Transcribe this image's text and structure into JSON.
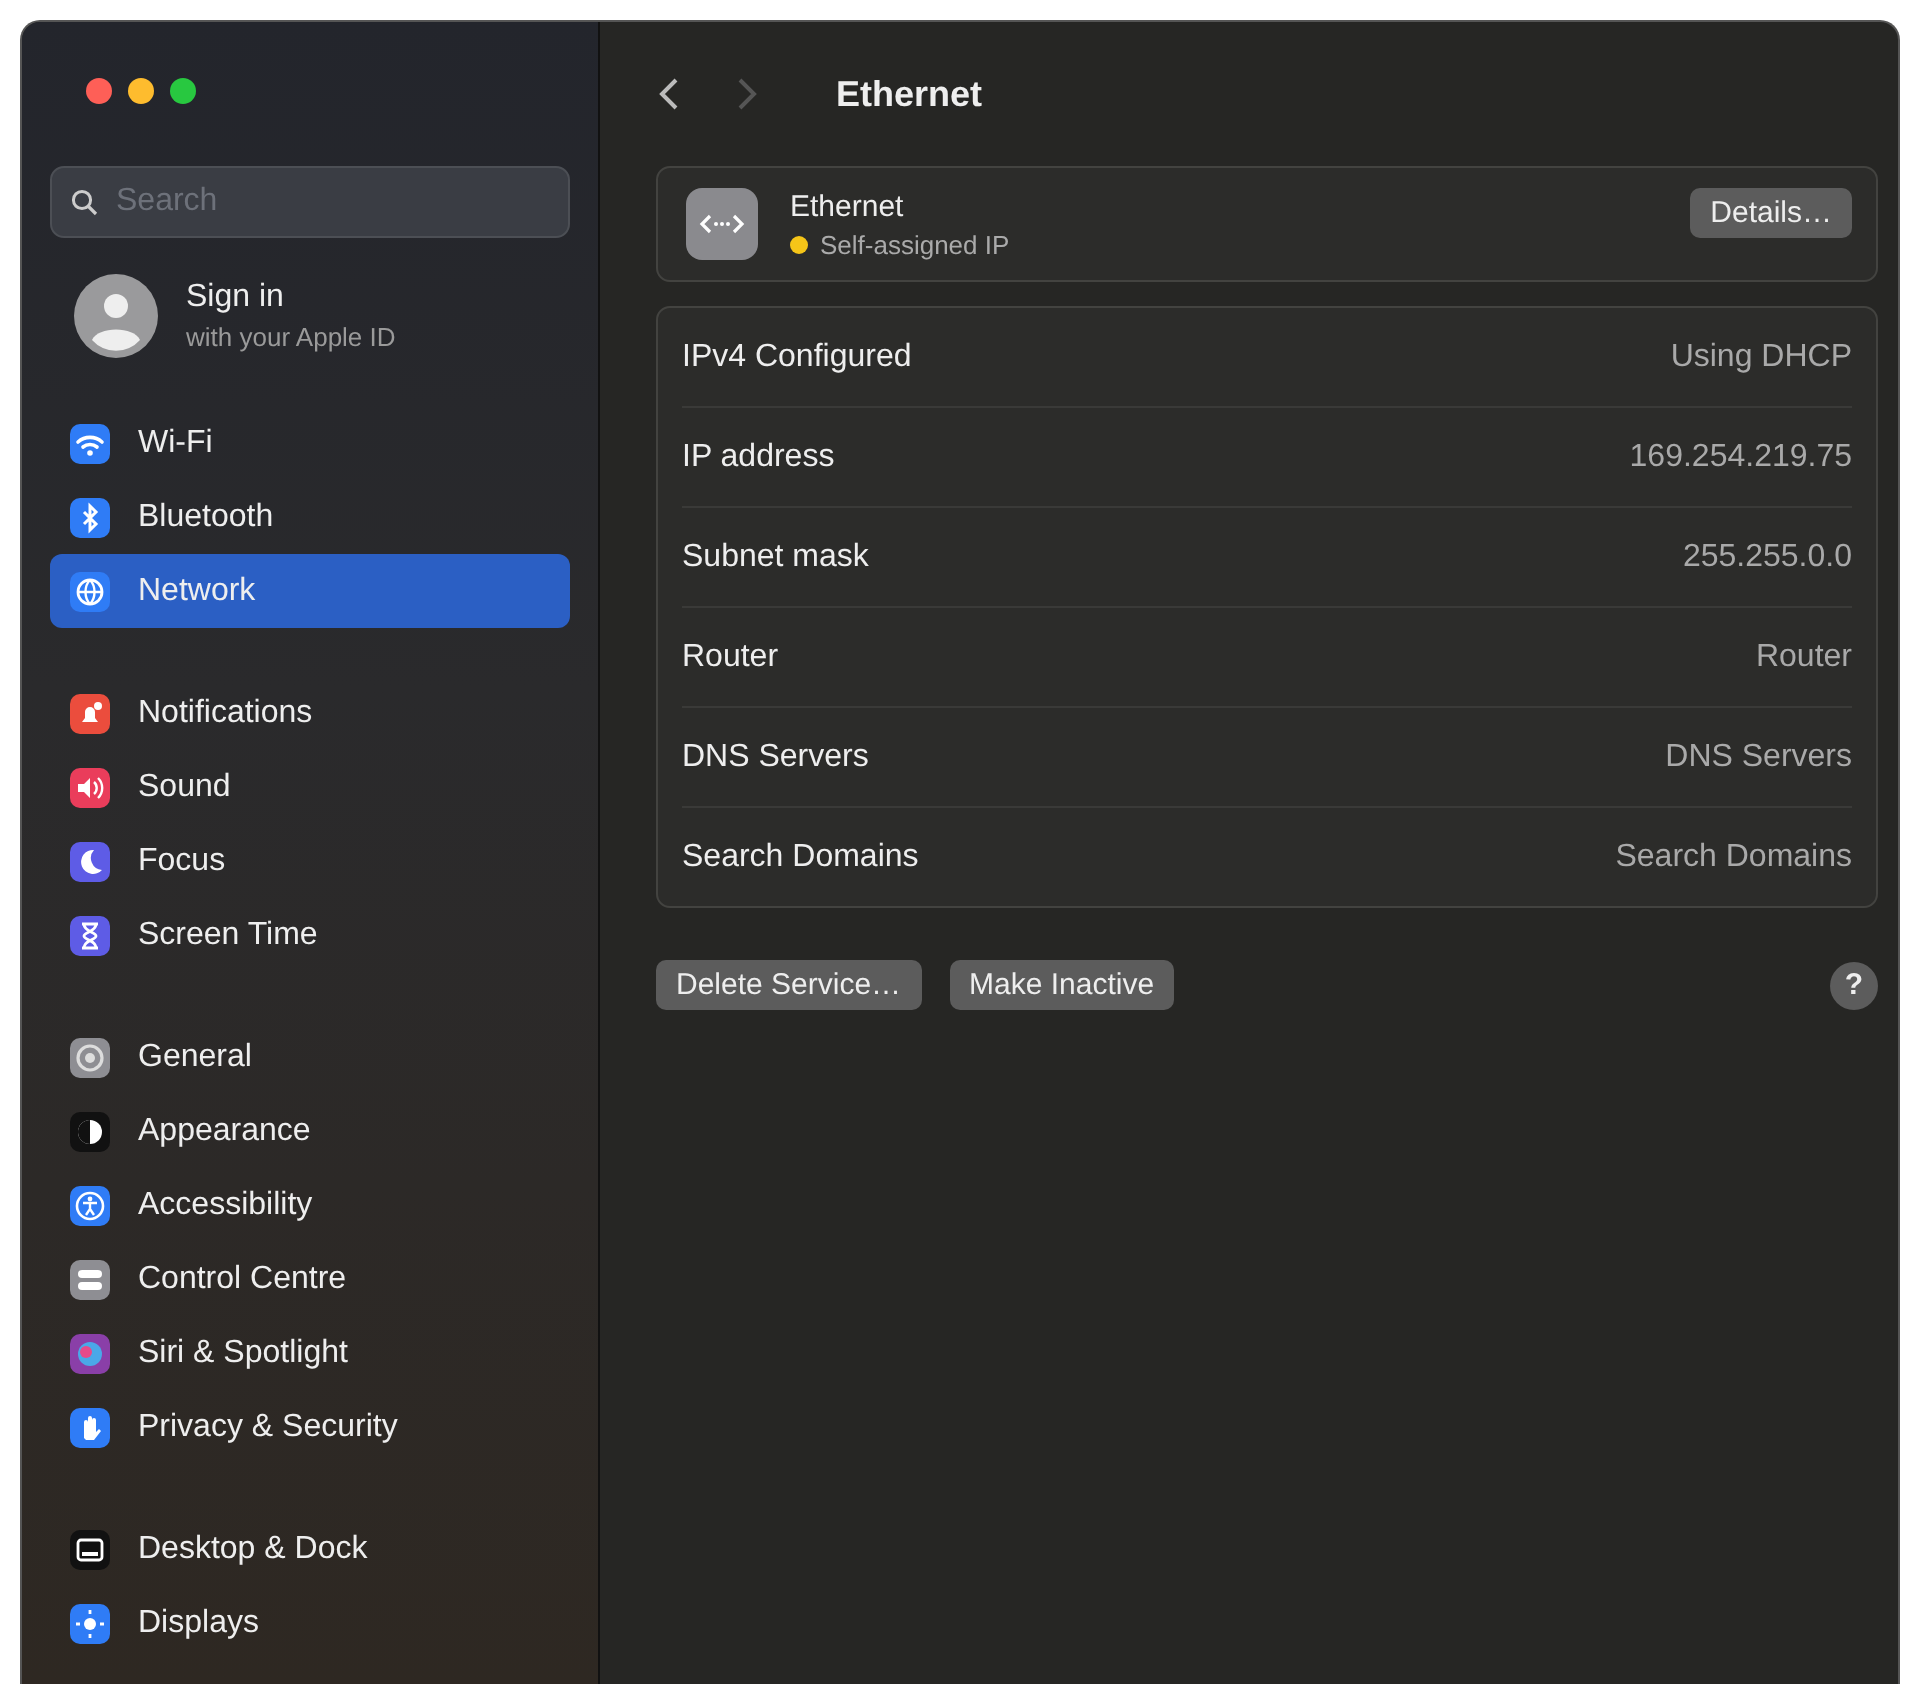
{
  "window": {
    "controls": [
      {
        "color": "#fe5f57"
      },
      {
        "color": "#febc2e"
      },
      {
        "color": "#28c840"
      }
    ]
  },
  "sidebar": {
    "search": {
      "placeholder": "Search"
    },
    "account": {
      "title": "Sign in",
      "subtitle": "with your Apple ID"
    },
    "groups": [
      [
        {
          "label": "Wi-Fi",
          "color": "#2f7cf6",
          "selected": false
        },
        {
          "label": "Bluetooth",
          "color": "#2f7cf6",
          "selected": false
        },
        {
          "label": "Network",
          "color": "#2f7cf6",
          "selected": true
        }
      ],
      [
        {
          "label": "Notifications",
          "color": "#eb4d3d",
          "selected": false
        },
        {
          "label": "Sound",
          "color": "#ea3d5b",
          "selected": false
        },
        {
          "label": "Focus",
          "color": "#5e5ce6",
          "selected": false
        },
        {
          "label": "Screen Time",
          "color": "#5e5ce6",
          "selected": false
        }
      ],
      [
        {
          "label": "General",
          "color": "#8e8e93",
          "selected": false
        },
        {
          "label": "Appearance",
          "color": "#111111",
          "selected": false
        },
        {
          "label": "Accessibility",
          "color": "#2f7cf6",
          "selected": false
        },
        {
          "label": "Control Centre",
          "color": "#8e8e93",
          "selected": false
        },
        {
          "label": "Siri & Spotlight",
          "color": "#8a3fa8",
          "selected": false
        },
        {
          "label": "Privacy & Security",
          "color": "#2f7cf6",
          "selected": false
        }
      ],
      [
        {
          "label": "Desktop & Dock",
          "color": "#111111",
          "selected": false
        },
        {
          "label": "Displays",
          "color": "#2f7cf6",
          "selected": false
        }
      ]
    ]
  },
  "toolbar": {
    "title": "Ethernet",
    "back_enabled": true,
    "forward_enabled": false
  },
  "service": {
    "name": "Ethernet",
    "status": {
      "label": "Self-assigned IP",
      "color": "#f5c518"
    },
    "button": "Details…"
  },
  "details": [
    {
      "label": "IPv4 Configured",
      "value": "Using DHCP"
    },
    {
      "label": "IP address",
      "value": "169.254.219.75"
    },
    {
      "label": "Subnet mask",
      "value": "255.255.0.0"
    },
    {
      "label": "Router",
      "value": "Router"
    },
    {
      "label": "DNS Servers",
      "value": "DNS Servers"
    },
    {
      "label": "Search Domains",
      "value": "Search Domains"
    }
  ],
  "buttons": [
    "Delete Service…",
    "Make Inactive"
  ],
  "help": "?"
}
